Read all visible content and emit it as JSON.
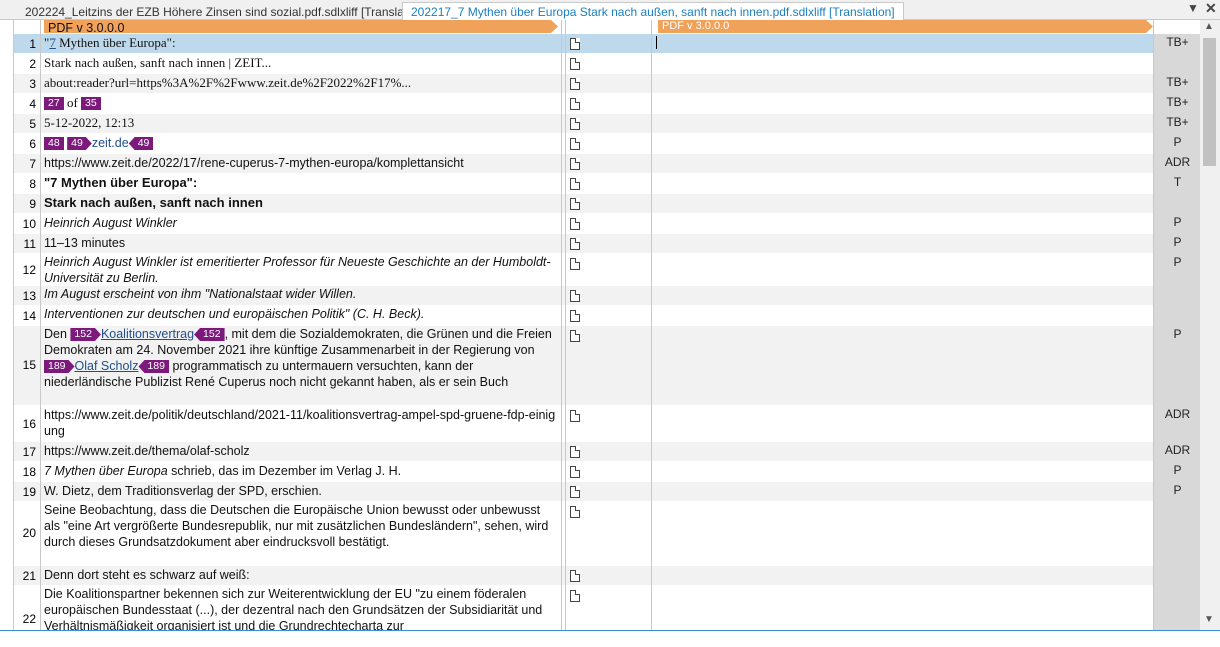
{
  "tabs": [
    {
      "label": "202224_Leitzins der EZB Höhere Zinsen sind sozial.pdf.sdlxliff [Translation]"
    },
    {
      "label": "202217_7 Mythen über Europa Stark nach außen, sanft nach innen.pdf.sdlxliff [Translation]"
    }
  ],
  "window": {
    "chevron": "▼",
    "close": "✕"
  },
  "header": {
    "source_tag": "PDF v 3.0.0.0",
    "target_tag": "PDF v 3.0.0.0"
  },
  "rows": [
    {
      "n": "1",
      "status": "TB+"
    },
    {
      "n": "2",
      "text": "Stark nach außen, sanft nach innen | ZEIT...",
      "status": ""
    },
    {
      "n": "3",
      "text": "about:reader?url=https%3A%2F%2Fwww.zeit.de%2F2022%2F17%...",
      "status": "TB+"
    },
    {
      "n": "4",
      "tag_a": "27",
      "of": "of",
      "tag_b": "35",
      "status": "TB+"
    },
    {
      "n": "5",
      "text": "5-12-2022, 12:13",
      "status": "TB+"
    },
    {
      "n": "6",
      "tag_a": "48",
      "tag_b": "49",
      "link": "zeit.de",
      "tag_c": "49",
      "status": "P"
    },
    {
      "n": "7",
      "text": "https://www.zeit.de/2022/17/rene-cuperus-7-mythen-europa/komplettansicht",
      "status": "ADR"
    },
    {
      "n": "8",
      "text": "\"7 Mythen über Europa\":",
      "status": "T"
    },
    {
      "n": "9",
      "text": "Stark nach außen, sanft nach innen",
      "status": ""
    },
    {
      "n": "10",
      "text": "Heinrich August Winkler",
      "status": "P"
    },
    {
      "n": "11",
      "text": "11–13 minutes",
      "status": "P"
    },
    {
      "n": "12",
      "text": "Heinrich August Winkler ist emeritierter Professor für Neueste Geschichte an der Humboldt-Universität zu Berlin.",
      "status": "P"
    },
    {
      "n": "13",
      "text": "Im August erscheint von ihm \"Nationalstaat wider Willen.",
      "status": ""
    },
    {
      "n": "14",
      "text": "Interventionen zur deutschen und europäischen Politik\" (C. H. Beck).",
      "status": ""
    },
    {
      "n": "15",
      "status": "P"
    },
    {
      "n": "16",
      "text": "https://www.zeit.de/politik/deutschland/2021-11/koalitionsvertrag-ampel-spd-gruene-fdp-einigung",
      "status": "ADR"
    },
    {
      "n": "17",
      "text": "https://www.zeit.de/thema/olaf-scholz",
      "status": "ADR"
    },
    {
      "n": "18",
      "status": "P"
    },
    {
      "n": "19",
      "text": "W. Dietz, dem Traditionsverlag der SPD, erschien.",
      "status": "P"
    },
    {
      "n": "20",
      "text": "Seine Beobachtung, dass die Deutschen die Europäische Union bewusst oder unbewusst als \"eine Art vergrößerte Bundesrepublik, nur mit zusätzlichen Bundesländern\", sehen, wird durch dieses Grundsatzdokument aber eindrucksvoll bestätigt.",
      "status": ""
    },
    {
      "n": "21",
      "text": "Denn dort steht es schwarz auf weiß:",
      "status": ""
    },
    {
      "n": "22",
      "text": "Die Koalitionspartner bekennen sich zur Weiterentwicklung der EU \"zu einem föderalen europäischen Bundesstaat (...), der dezentral nach den Grundsätzen der Subsidiarität und Verhältnismäßigkeit organisiert ist und die Grundrechtecharta zur",
      "status": ""
    }
  ],
  "row1": {
    "q1": "\"",
    "link": "7",
    "rest": " Mythen über Europa\":"
  },
  "row15": {
    "t1": "Den ",
    "tag1": "152",
    "link1": "Koalitionsvertrag",
    "tag2": "152",
    "t2": ", mit dem die Sozialdemokraten, die Grünen und die Freien Demokraten am 24. November 2021 ihre künftige Zusammenarbeit in der Regierung von ",
    "tag3": "189",
    "link2": "Olaf Scholz",
    "tag4": "189",
    "t3": " programmatisch zu untermauern versuchten, kann der niederländische Publizist René Cuperus noch nicht gekannt haben, als er sein Buch"
  },
  "row18": {
    "ital": "7 Mythen über Europa",
    "rest": " schrieb, das im Dezember im Verlag J. H."
  },
  "scroll": {
    "up": "▲",
    "down": "▼"
  }
}
